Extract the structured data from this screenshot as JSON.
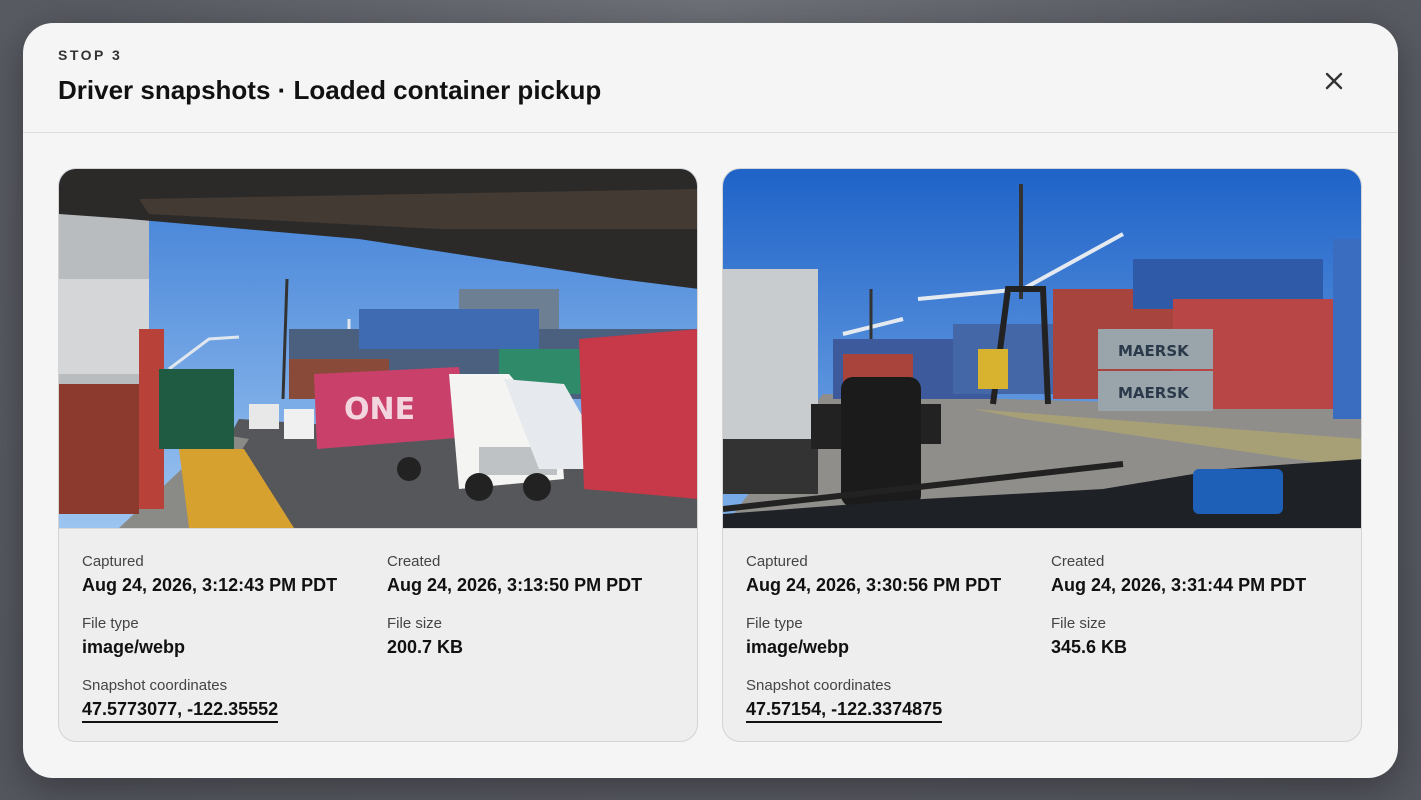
{
  "modal": {
    "eyebrow": "STOP 3",
    "title": "Driver snapshots · Loaded container pickup",
    "close_icon": "close-icon"
  },
  "labels": {
    "captured": "Captured",
    "created": "Created",
    "file_type": "File type",
    "file_size": "File size",
    "coordinates": "Snapshot coordinates"
  },
  "snapshots": [
    {
      "image": "Port terminal road viewed through truck windshield with white semi trucks hauling red ONE containers, container stacks and cranes under blue sky",
      "captured": "Aug 24, 2026, 3:12:43 PM PDT",
      "created": "Aug 24, 2026, 3:13:50 PM PDT",
      "file_type": "image/webp",
      "file_size": "200.7 KB",
      "coordinates": "47.5773077, -122.35552"
    },
    {
      "image": "Container yard through windshield with phone mount, straddle carrier, stacked Maersk containers and gantry cranes under blue sky",
      "captured": "Aug 24, 2026, 3:30:56 PM PDT",
      "created": "Aug 24, 2026, 3:31:44 PM PDT",
      "file_type": "image/webp",
      "file_size": "345.6 KB",
      "coordinates": "47.57154, -122.3374875"
    }
  ]
}
